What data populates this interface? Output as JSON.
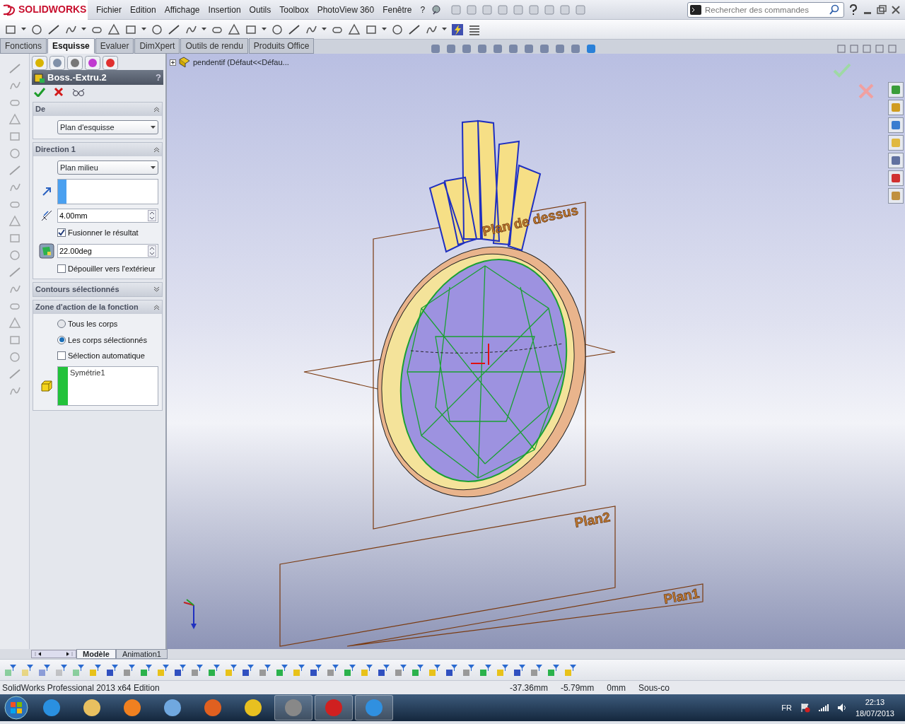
{
  "app": {
    "logo": "SOLIDWORKS"
  },
  "menu": [
    "Fichier",
    "Edition",
    "Affichage",
    "Insertion",
    "Outils",
    "Toolbox",
    "PhotoView 360",
    "Fenêtre",
    "?"
  ],
  "search": {
    "placeholder": "Rechercher des commandes"
  },
  "command_tabs": [
    {
      "label": "Fonctions",
      "selected": false
    },
    {
      "label": "Esquisse",
      "selected": true
    },
    {
      "label": "Evaluer",
      "selected": false
    },
    {
      "label": "DimXpert",
      "selected": false
    },
    {
      "label": "Outils de rendu",
      "selected": false
    },
    {
      "label": "Produits Office",
      "selected": false
    }
  ],
  "property_manager": {
    "title": "Boss.-Extru.2",
    "help": "?",
    "sections": [
      {
        "title": "De",
        "expanded": true,
        "controls": [
          {
            "kind": "select",
            "value": "Plan d'esquisse"
          }
        ]
      },
      {
        "title": "Direction 1",
        "expanded": true,
        "controls": [
          {
            "kind": "select",
            "value": "Plan milieu"
          },
          {
            "kind": "direction-list"
          },
          {
            "kind": "depth",
            "value": "4.00mm"
          },
          {
            "kind": "checkbox",
            "label": "Fusionner le résultat",
            "checked": true
          },
          {
            "kind": "draft-angle",
            "value": "22.00deg"
          },
          {
            "kind": "checkbox",
            "label": "Dépouiller vers l'extérieur",
            "checked": false
          }
        ]
      },
      {
        "title": "Contours sélectionnés",
        "expanded": false
      },
      {
        "title": "Zone d'action de la fonction",
        "expanded": true,
        "controls": [
          {
            "kind": "radio",
            "label": "Tous les corps",
            "selected": false
          },
          {
            "kind": "radio",
            "label": "Les corps sélectionnés",
            "selected": true
          },
          {
            "kind": "checkbox",
            "label": "Sélection automatique",
            "checked": false
          },
          {
            "kind": "body-list",
            "items": [
              "Symétrie1"
            ]
          }
        ]
      }
    ]
  },
  "viewport": {
    "tree_flyout": "pendentif  (Défaut<<Défau...",
    "plane_labels": [
      "Plan de dessus",
      "Plan2",
      "Plan1"
    ]
  },
  "bottom_tabs": [
    {
      "label": "Modèle",
      "selected": true
    },
    {
      "label": "Animation1",
      "selected": false
    }
  ],
  "status_bar": {
    "text": "SolidWorks Professional 2013 x64 Edition",
    "fields": [
      "-37.36mm",
      "-5.79mm",
      "0mm",
      "Sous-co"
    ]
  },
  "taskbar": {
    "language": "FR",
    "time": "22:13",
    "date": "18/07/2013"
  }
}
